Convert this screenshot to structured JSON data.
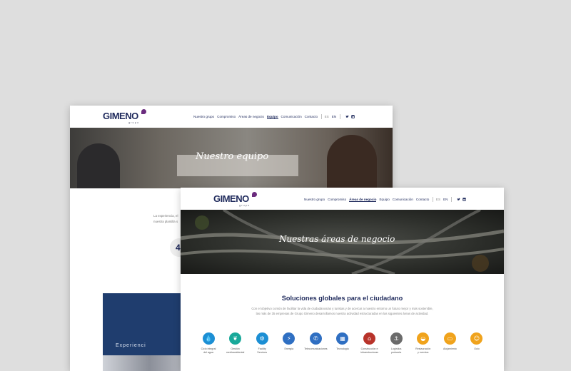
{
  "back_window": {
    "logo": {
      "text": "GIMENO",
      "sub": "grupo"
    },
    "nav": {
      "items": [
        "Nuestro grupo",
        "Compromiso",
        "Áreas de negocio",
        "Equipo",
        "Comunicación",
        "Contacto"
      ],
      "active_index": 3,
      "langs": [
        "ES",
        "EN"
      ],
      "social_icons": [
        "twitter-icon",
        "linkedin-icon"
      ]
    },
    "hero_title": "Nuestro equipo",
    "intro_line1": "La experiencia, el",
    "intro_line2": "nuestra plantilla s",
    "counter": "4",
    "panel_text": "Experienci"
  },
  "front_window": {
    "logo": {
      "text": "GIMENO",
      "sub": "grupo"
    },
    "nav": {
      "items": [
        "Nuestro grupo",
        "Compromiso",
        "Áreas de negocio",
        "Equipo",
        "Comunicación",
        "Contacto"
      ],
      "active_index": 2,
      "langs": [
        "ES",
        "EN"
      ],
      "social_icons": [
        "twitter-icon",
        "linkedin-icon"
      ]
    },
    "hero_title": "Nuestras áreas de negocio",
    "section_title": "Soluciones globales para el ciudadano",
    "section_text_1": "Con el objetivo común de facilitar la vida de ciudadanos/as y turistas y de acercar a nuestro entorno un futuro mejor y más sostenible,",
    "section_text_2": "las más de 35 empresas de Grupo Gimeno desarrollamos nuestra actividad estructuradas en las siguientes áreas de actividad.",
    "services": [
      {
        "label": "Ciclo integral\ndel agua",
        "color": "#1c8fd4",
        "icon": "water-drop-icon"
      },
      {
        "label": "Gestión\nmedioambiental",
        "color": "#19a99a",
        "icon": "leaf-icon"
      },
      {
        "label": "Facility\nServices",
        "color": "#1c8fd4",
        "icon": "building-services-icon"
      },
      {
        "label": "Energía",
        "color": "#2f6fc2",
        "icon": "energy-bolt-icon"
      },
      {
        "label": "Telecomunicaciones",
        "color": "#2f6fc2",
        "icon": "antenna-icon"
      },
      {
        "label": "Tecnología",
        "color": "#2f6fc2",
        "icon": "chip-icon"
      },
      {
        "label": "Construcción e\ninfraestructuras",
        "color": "#b8332a",
        "icon": "crane-icon"
      },
      {
        "label": "Logística\nportuaria",
        "color": "#6b6b6b",
        "icon": "port-icon"
      },
      {
        "label": "Restauración\ny eventos",
        "color": "#f0a31c",
        "icon": "cloche-icon"
      },
      {
        "label": "Alojamiento",
        "color": "#f0a31c",
        "icon": "bed-icon"
      },
      {
        "label": "Ocio",
        "color": "#f0a31c",
        "icon": "smile-icon"
      }
    ]
  }
}
